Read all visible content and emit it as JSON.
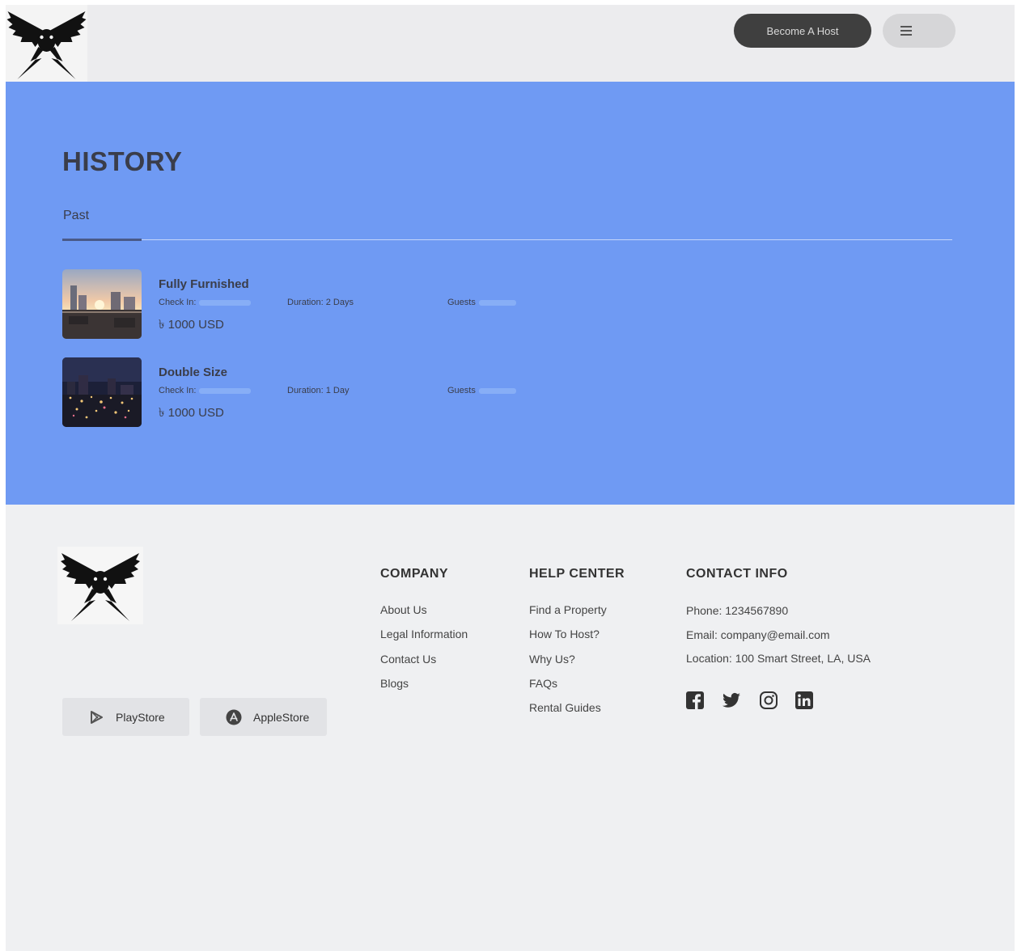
{
  "header": {
    "become_host_label": "Become A Host"
  },
  "history": {
    "title": "HISTORY",
    "tabs": [
      {
        "label": "Past"
      }
    ],
    "bookings": [
      {
        "name": "Fully Furnished",
        "check_in_label": "Check In:",
        "duration_label": "Duration:",
        "duration_value": "2 Days",
        "guests_label": "Guests",
        "price": "৳ 1000 USD"
      },
      {
        "name": "Double Size",
        "check_in_label": "Check In:",
        "duration_label": "Duration:",
        "duration_value": "1 Day",
        "guests_label": "Guests",
        "price": "৳ 1000 USD"
      }
    ]
  },
  "footer": {
    "stores": [
      {
        "label": "PlayStore",
        "icon": "play-icon"
      },
      {
        "label": "AppleStore",
        "icon": "app-store-icon"
      }
    ],
    "company": {
      "heading": "COMPANY",
      "links": [
        "About Us",
        "Legal Information",
        "Contact Us",
        "Blogs"
      ]
    },
    "help_center": {
      "heading": "HELP CENTER",
      "links": [
        "Find a Property",
        "How To Host?",
        "Why Us?",
        "FAQs",
        "Rental Guides"
      ]
    },
    "contact": {
      "heading": "CONTACT INFO",
      "phone": "Phone: 1234567890",
      "email": "Email: company@email.com",
      "location": "Location: 100 Smart Street, LA, USA"
    },
    "social_icons": [
      "facebook-icon",
      "twitter-icon",
      "instagram-icon",
      "linkedin-icon"
    ]
  },
  "colors": {
    "hero_bg": "#6f9af3",
    "page_bg": "#eff0f2",
    "header_bg": "#ececee",
    "button_dark": "#3f3f3f"
  }
}
